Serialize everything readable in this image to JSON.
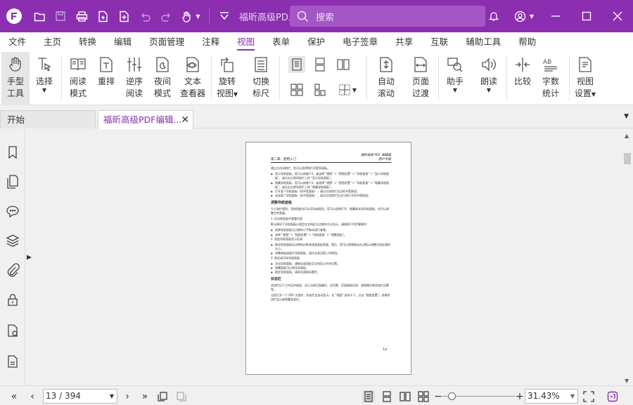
{
  "titlebar": {
    "document_title": "福昕高级PD...",
    "search_placeholder": "搜索"
  },
  "menu": {
    "items": [
      {
        "label": "文件"
      },
      {
        "label": "主页"
      },
      {
        "label": "转换"
      },
      {
        "label": "编辑"
      },
      {
        "label": "页面管理"
      },
      {
        "label": "注释"
      },
      {
        "label": "视图",
        "active": true
      },
      {
        "label": "表单"
      },
      {
        "label": "保护"
      },
      {
        "label": "电子签章"
      },
      {
        "label": "共享"
      },
      {
        "label": "互联"
      },
      {
        "label": "辅助工具"
      },
      {
        "label": "帮助"
      }
    ]
  },
  "ribbon": {
    "hand_tool": {
      "line1": "手型",
      "line2": "工具"
    },
    "select": {
      "line1": "选择"
    },
    "read_mode": {
      "line1": "阅读",
      "line2": "模式"
    },
    "reflow": {
      "line1": "重排"
    },
    "reverse_read": {
      "line1": "逆序",
      "line2": "阅读"
    },
    "night_mode": {
      "line1": "夜间",
      "line2": "模式"
    },
    "text_viewer": {
      "line1": "文本",
      "line2": "查看器"
    },
    "rotate_view": {
      "line1": "旋转",
      "line2": "视图"
    },
    "ruler": {
      "line1": "切换",
      "line2": "标尺"
    },
    "auto_scroll": {
      "line1": "自动",
      "line2": "滚动"
    },
    "page_transition": {
      "line1": "页面",
      "line2": "过渡"
    },
    "assistant": {
      "line1": "助手"
    },
    "read_aloud": {
      "line1": "朗读"
    },
    "compare": {
      "line1": "比较"
    },
    "word_count": {
      "line1": "字数",
      "line2": "统计"
    },
    "view_settings": {
      "line1": "视图",
      "line2": "设置"
    }
  },
  "tabs": [
    {
      "label": "开始"
    },
    {
      "label": "福昕高级PDF编辑...",
      "active": true
    }
  ],
  "pdf_page": {
    "header_right_1": "福昕高级 PDF 编辑器",
    "header_right_2": "用户手册",
    "header_left": "第二章：使用入门",
    "lines": [
      {
        "t": "p",
        "text": "通过点击导航栏，您可以选择和打开更多面板。"
      },
      {
        "t": "bl",
        "text": "显示导航面板，您可以按键 F4，或选择 \"视图\" > \"视图设置\" > \"导航面板\" > \"显示导航面板\"，或点击左侧导航栏上的 \"显示导航面板\"。"
      },
      {
        "t": "bl",
        "text": "隐藏导航面板，您可以按键 F4，或选择 \"视图\" > \"视图设置\" > \"导航面板\" > \"隐藏导航面板\"，或点击左侧导航栏上的 \"隐藏导航面板\"。"
      },
      {
        "t": "bl",
        "text": "打开某个导航面板（如书签面板），请点击导航栏左边的书签按钮。"
      },
      {
        "t": "bl",
        "text": "关闭某个导航面板（如书签面板），请点击导航栏左边已经打开的书签按钮。"
      },
      {
        "t": "h",
        "text": "调整导航面板"
      },
      {
        "t": "p",
        "text": "与工具栏相同，导航面板也可以浮动或固定。您可以选择打开、隐藏或关闭导航面板，也可以调整它的宽度。"
      },
      {
        "t": "p",
        "text": "1. 在导航面板中查看内容"
      },
      {
        "t": "p",
        "text": "默认情况下导航面板以固定在文档区左边缘的方式显示。请按照下列步骤操作："
      },
      {
        "t": "bl",
        "text": "选择导航面板左边缘的小手拖动进行查看。"
      },
      {
        "t": "bl",
        "text": "选择 \"视图\" > \"视图设置\" > \"导航面板\" > \"调整面板\"。"
      },
      {
        "t": "p",
        "text": "2. 改变导航面板显示区域"
      },
      {
        "t": "bl",
        "text": "拖动导航面板右边缘的边框来改变面板宽度，然后，您可以直接拖动左边框以调整文档区域的大小。"
      },
      {
        "t": "bl",
        "text": "如需收起或展开导航面板，请点击其边框上的按钮。"
      },
      {
        "t": "p",
        "text": "3. 固定或浮动导航面板"
      },
      {
        "t": "bl",
        "text": "浮动导航面板，请拖动该面板至文档区以外的位置。"
      },
      {
        "t": "bl",
        "text": "隐藏面板可以将浮动面板。"
      },
      {
        "t": "bl",
        "text": "固定导航面板，请双击面板标题栏。"
      },
      {
        "t": "h",
        "text": "状态栏"
      },
      {
        "t": "p",
        "text": "状态栏位于工作区的底部，显示当前页面编号、总页数、页面缩放比例、视图模式和状态栏设置等。"
      },
      {
        "t": "p",
        "text": "当您打开一个 PDF 文档时，状态栏会自动显示。在 \"视图\" 选项卡下，点击 \"视图设置\"，选择状态栏显示或隐藏状态栏。"
      }
    ],
    "page_number": "14"
  },
  "statusbar": {
    "page_indicator": "13 / 394",
    "zoom_value": "31.43%"
  },
  "colors": {
    "brand": "#8b2fb0",
    "search_bg": "#a457c4"
  }
}
